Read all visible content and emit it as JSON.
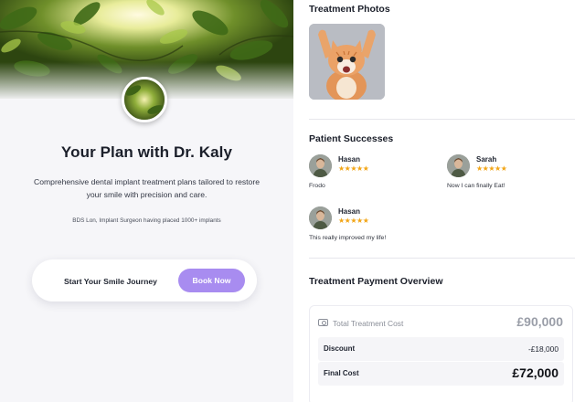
{
  "plan": {
    "title": "Your Plan with Dr. Kaly",
    "description": "Comprehensive dental implant treatment plans tailored to restore your smile with precision and care.",
    "credentials": "BDS Lon, Implant Surgeon having placed 1000+ implants",
    "cta_label": "Start Your Smile Journey",
    "book_button": "Book Now"
  },
  "photos": {
    "title": "Treatment Photos"
  },
  "successes": {
    "title": "Patient Successes",
    "items": [
      {
        "name": "Hasan",
        "stars": "★★★★★",
        "quote": "Frodo"
      },
      {
        "name": "Sarah",
        "stars": "★★★★★",
        "quote": "Now I can finally Eat!"
      },
      {
        "name": "Hasan",
        "stars": "★★★★★",
        "quote": "This really improved my life!"
      }
    ]
  },
  "payment": {
    "title": "Treatment Payment Overview",
    "total_label": "Total Treatment Cost",
    "total_value": "£90,000",
    "discount_label": "Discount",
    "discount_value": "-£18,000",
    "final_label": "Final Cost",
    "final_value": "£72,000"
  },
  "colors": {
    "accent": "#a88cf0",
    "star": "#f2a516",
    "left_bg": "#f6f6f9"
  }
}
